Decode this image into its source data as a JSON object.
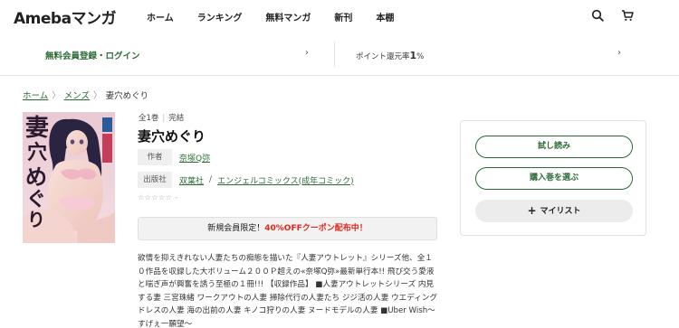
{
  "header": {
    "logo": "Amebaマンガ",
    "nav": [
      "ホーム",
      "ランキング",
      "無料マンガ",
      "新刊",
      "本棚"
    ],
    "icons": [
      "search-icon",
      "cart-icon"
    ]
  },
  "infobar": {
    "signup_label": "無料会員登録・ログイン",
    "points_label": "ポイント還元率",
    "points_value": "1",
    "points_unit": "%"
  },
  "breadcrumb": {
    "items": [
      "ホーム",
      "メンズ",
      "妻穴めぐり"
    ],
    "separator": "〉"
  },
  "book": {
    "volumes": "全1巻",
    "status": "完結",
    "title": "妻穴めぐり",
    "author_label": "作者",
    "author": "奈塚Q弥",
    "publisher_label": "出版社",
    "publisher": "双葉社",
    "publisher_sep": "/",
    "label": "エンジェルコミックス(成年コミック)",
    "stars": "☆☆☆☆☆ -",
    "rating_max": 5
  },
  "promo": {
    "prefix": "新規会員限定！",
    "highlight": "40%OFFクーポン配布中！"
  },
  "description": "欲情を抑えきれない人妻たちの痴態を描いた『人妻アウトレット』シリーズ他、全１０作品を収録した大ボリューム２００Ｐ超えの«奈塚Q弥»最新単行本!! 飛び交う愛液と喘ぎ声が興奮を誘う至極の１冊!!! 【収録作品】 ■人妻アウトレットシリーズ 内見する妻 三宮珠緒 ワークアウトの人妻 掃除代行の人妻たち ジジ活の人妻 ウエディングドレスの人妻 海の出前の人妻 キノコ狩りの人妻 ヌードモデルの人妻 ■Uber Wish〜すげぇ一願望〜",
  "actions": {
    "trial": "試し読み",
    "purchase": "購入巻を選ぶ",
    "mylist": "マイリスト",
    "mylist_icon": "+"
  },
  "colors": {
    "accent_green": "#2c6b35",
    "promo_red": "#e0281c"
  }
}
